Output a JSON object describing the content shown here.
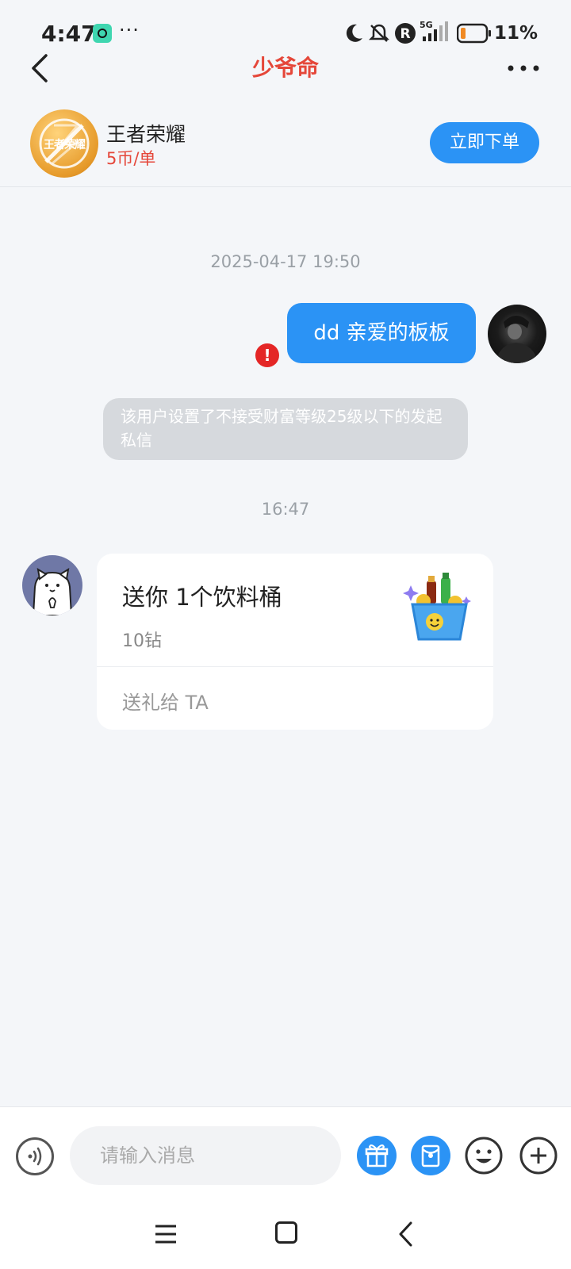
{
  "status_bar": {
    "time": "4:47",
    "more": "···",
    "battery": "11%"
  },
  "header": {
    "title": "少爷命"
  },
  "game_card": {
    "logo_text": "王者荣耀",
    "name": "王者荣耀",
    "price": "5币/单",
    "order_button": "立即下单"
  },
  "messages": {
    "timestamp_1": "2025-04-17 19:50",
    "my_message": "dd 亲爱的板板",
    "system_notice": "该用户设置了不接受财富等级25级以下的发起私信",
    "timestamp_2": "16:47",
    "gift": {
      "title": "送你 1个饮料桶",
      "price": "10钻",
      "send_label": "送礼给 TA"
    }
  },
  "input_bar": {
    "placeholder": "请输入消息"
  },
  "colors": {
    "accent_blue": "#2b93f5",
    "title_red": "#e5473a",
    "error_red": "#e42626"
  }
}
